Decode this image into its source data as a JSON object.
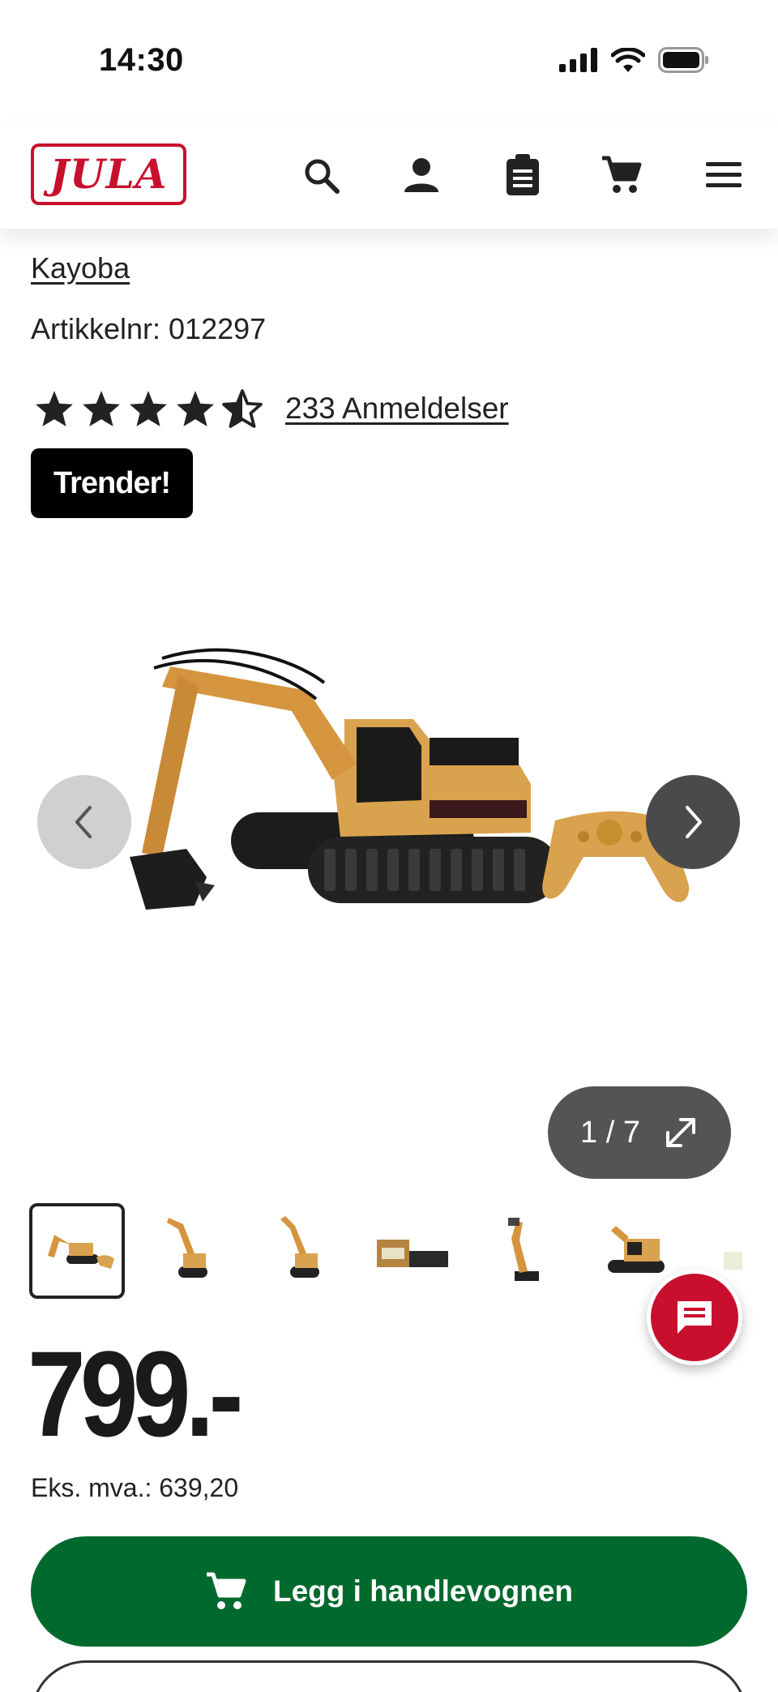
{
  "status_bar": {
    "time": "14:30"
  },
  "header": {
    "logo_text": "JULA",
    "icons": [
      "search-icon",
      "account-icon",
      "clipboard-icon",
      "cart-icon",
      "menu-icon"
    ]
  },
  "product": {
    "brand": "Kayoba",
    "article_number": "Artikkelnr: 012297",
    "rating": 4.5,
    "reviews_text": "233 Anmeldelser",
    "badge": "Trender!",
    "gallery_counter": "1 / 7",
    "thumbnail_count": 7,
    "price": "799.-",
    "ex_vat": "Eks. mva.: 639,20"
  },
  "actions": {
    "add_to_cart": "Legg i handlevognen"
  },
  "colors": {
    "brand_red": "#c8102e",
    "cart_green": "#00692d",
    "badge_black": "#000000",
    "excavator_yellow": "#d9a24e"
  }
}
